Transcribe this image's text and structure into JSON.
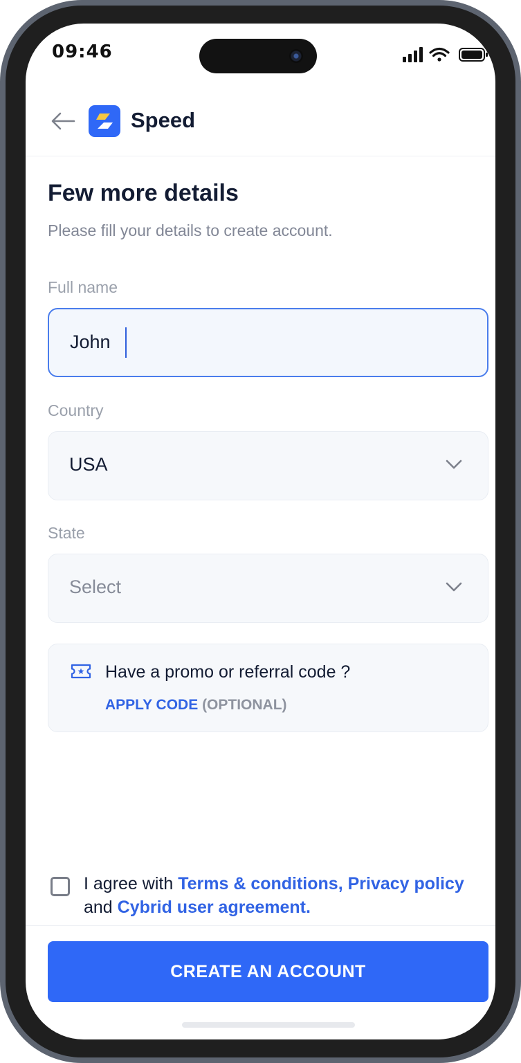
{
  "status_bar": {
    "time": "09:46"
  },
  "header": {
    "brand": "Speed"
  },
  "page": {
    "title": "Few more details",
    "subtitle": "Please fill your details to create account."
  },
  "form": {
    "full_name": {
      "label": "Full name",
      "value": "John"
    },
    "country": {
      "label": "Country",
      "value": "USA"
    },
    "state": {
      "label": "State",
      "placeholder": "Select"
    }
  },
  "promo": {
    "title": "Have a promo or referral code ?",
    "apply_label": "APPLY CODE",
    "optional_label": "(OPTIONAL)"
  },
  "agreement": {
    "prefix": "I agree with ",
    "terms_link": "Terms & conditions,",
    "privacy_link": "Privacy policy",
    "and_text": " and ",
    "cybrid_link": "Cybrid user agreement.",
    "checked": false
  },
  "cta": {
    "label": "CREATE AN ACCOUNT"
  },
  "colors": {
    "primary": "#2f68f7",
    "link": "#3163e4",
    "heading": "#131c33",
    "muted": "#828796",
    "field_bg": "#f6f8fb",
    "active_border": "#4a7dec"
  }
}
